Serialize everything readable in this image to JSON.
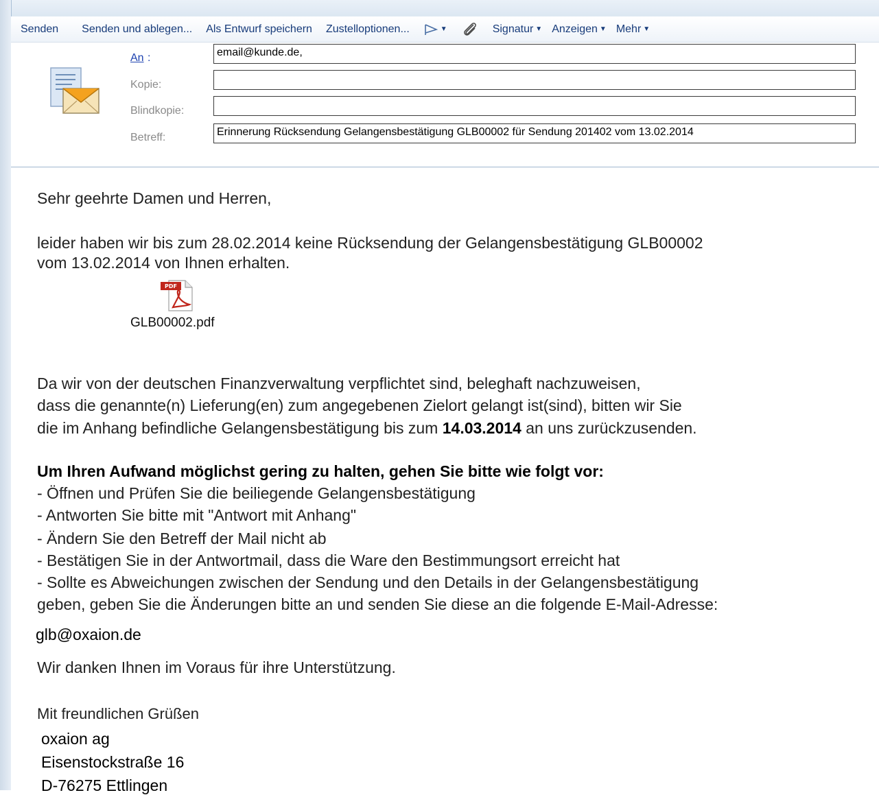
{
  "toolbar": {
    "send": "Senden",
    "send_and_file": "Senden und ablegen...",
    "save_draft": "Als Entwurf speichern",
    "delivery_options": "Zustelloptionen...",
    "signature": "Signatur",
    "display": "Anzeigen",
    "more": "Mehr"
  },
  "header": {
    "to_label": "An",
    "to_value": "email@kunde.de,",
    "cc_label": "Kopie:",
    "cc_value": "",
    "bcc_label": "Blindkopie:",
    "bcc_value": "",
    "subject_label": "Betreff:",
    "subject_value": "Erinnerung Rücksendung Gelangensbestätigung GLB00002 für Sendung 201402 vom 13.02.2014"
  },
  "body": {
    "greeting": "Sehr geehrte Damen und Herren,",
    "p1_line1": "leider haben wir bis zum 28.02.2014 keine Rücksendung der Gelangensbestätigung GLB00002",
    "p1_line2": "vom 13.02.2014 von Ihnen erhalten.",
    "attachment_name": "GLB00002.pdf",
    "attachment_badge": "PDF",
    "p2_line1": "Da wir von der deutschen Finanzverwaltung verpflichtet sind, beleghaft nachzuweisen,",
    "p2_line2": "dass die genannte(n) Lieferung(en) zum angegebenen Zielort gelangt ist(sind), bitten wir Sie",
    "p2_line3_a": "die im Anhang befindliche Gelangensbestätigung bis zum ",
    "p2_line3_date": "14.03.2014",
    "p2_line3_b": " an uns zurückzusenden.",
    "instructions_heading": "Um Ihren Aufwand möglichst gering zu halten, gehen Sie bitte wie folgt vor:",
    "steps": [
      "- Öffnen und Prüfen Sie die beiliegende Gelangensbestätigung",
      "- Antworten Sie bitte mit \"Antwort mit Anhang\"",
      "- Ändern Sie den Betreff der Mail nicht ab",
      "- Bestätigen Sie in der Antwortmail, dass die Ware den Bestimmungsort erreicht hat",
      "- Sollte es Abweichungen zwischen der Sendung und den Details in der Gelangensbestätigung",
      "geben, geben Sie die Änderungen bitte an und senden Sie diese an die folgende E-Mail-Adresse:"
    ],
    "contact_email": "glb@oxaion.de",
    "thanks": "Wir danken Ihnen im Voraus für ihre Unterstützung.",
    "closing": "Mit freundlichen Grüßen",
    "company": "oxaion ag",
    "street": "Eisenstockstraße 16",
    "city": "D-76275 Ettlingen"
  },
  "icons": {
    "envelope": "envelope-icon",
    "flag": "flag-icon",
    "paperclip": "paperclip-icon",
    "pdf": "pdf-icon"
  }
}
